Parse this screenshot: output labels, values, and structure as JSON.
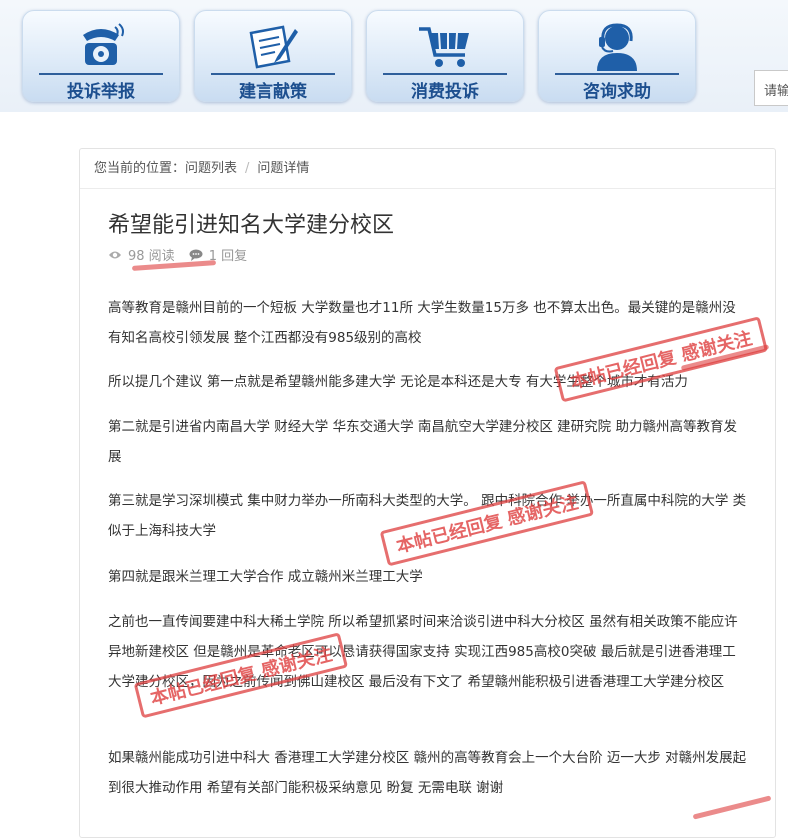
{
  "nav": {
    "items": [
      {
        "label": "投诉举报",
        "icon": "telephone-icon"
      },
      {
        "label": "建言献策",
        "icon": "pen-paper-icon"
      },
      {
        "label": "消费投诉",
        "icon": "cart-icon"
      },
      {
        "label": "咨询求助",
        "icon": "headset-person-icon"
      }
    ],
    "search_placeholder": "请输"
  },
  "breadcrumb": {
    "prefix": "您当前的位置：",
    "items": [
      "问题列表",
      "问题详情"
    ],
    "separator": "/"
  },
  "post": {
    "title": "希望能引进知名大学建分校区",
    "views": "98 阅读",
    "replies": "1 回复",
    "paragraphs": [
      "高等教育是赣州目前的一个短板 大学数量也才11所 大学生数量15万多  也不算太出色。最关键的是赣州没有知名高校引领发展 整个江西都没有985级别的高校",
      "所以提几个建议 第一点就是希望赣州能多建大学 无论是本科还是大专 有大学生整个城市才有活力",
      "第二就是引进省内南昌大学 财经大学  华东交通大学 南昌航空大学建分校区 建研究院 助力赣州高等教育发展",
      "第三就是学习深圳模式 集中财力举办一所南科大类型的大学。  跟中科院合作 举办一所直属中科院的大学 类似于上海科技大学",
      "第四就是跟米兰理工大学合作 成立赣州米兰理工大学",
      "之前也一直传闻要建中科大稀土学院 所以希望抓紧时间来洽谈引进中科大分校区  虽然有相关政策不能应许异地新建校区 但是赣州是革命老区可以恳请获得国家支持 实现江西985高校0突破 最后就是引进香港理工大学建分校区，因为之前传闻到佛山建校区 最后没有下文了 希望赣州能积极引进香港理工大学建分校区",
      "如果赣州能成功引进中科大 香港理工大学建分校区 赣州的高等教育会上一个大台阶 迈一大步  对赣州发展起到很大推动作用 希望有关部门能积极采纳意见 盼复 无需电联 谢谢"
    ]
  },
  "stamps": {
    "text": "本帖已经回复 感谢关注",
    "color": "#de3e3e"
  },
  "colors": {
    "nav_label": "#1d4f8f",
    "title": "#333333",
    "meta": "#999999"
  }
}
